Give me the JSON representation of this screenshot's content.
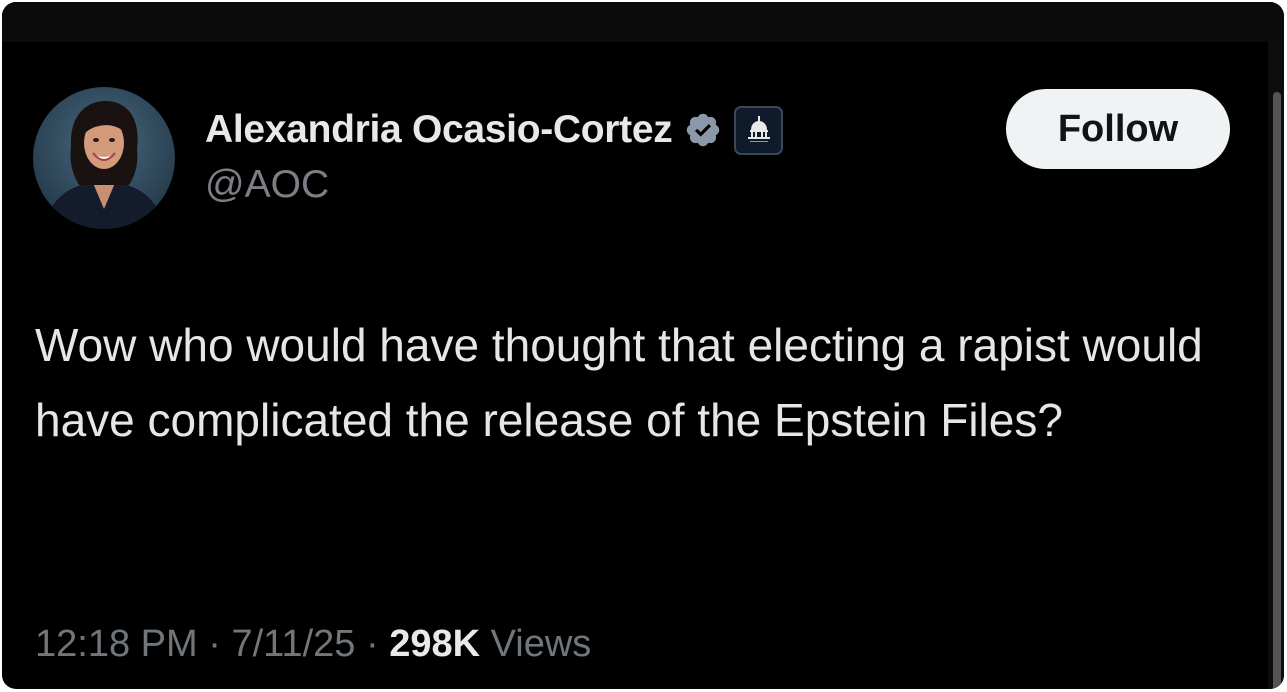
{
  "author": {
    "name": "Alexandria Ocasio-Cortez",
    "handle": "@AOC"
  },
  "follow_label": "Follow",
  "tweet_text": "Wow who would have thought that electing a rapist would have complicated the release of the Epstein Files?",
  "meta": {
    "time": "12:18 PM",
    "separator": "·",
    "date": "7/11/25",
    "views_count": "298K",
    "views_label": "Views"
  },
  "icons": {
    "verified": "verified-badge-icon",
    "affiliation": "us-capitol-icon"
  },
  "colors": {
    "background": "#000000",
    "verified_badge": "#8a98aa",
    "follow_button_bg": "#eff3f4",
    "secondary_text": "#71767b"
  }
}
